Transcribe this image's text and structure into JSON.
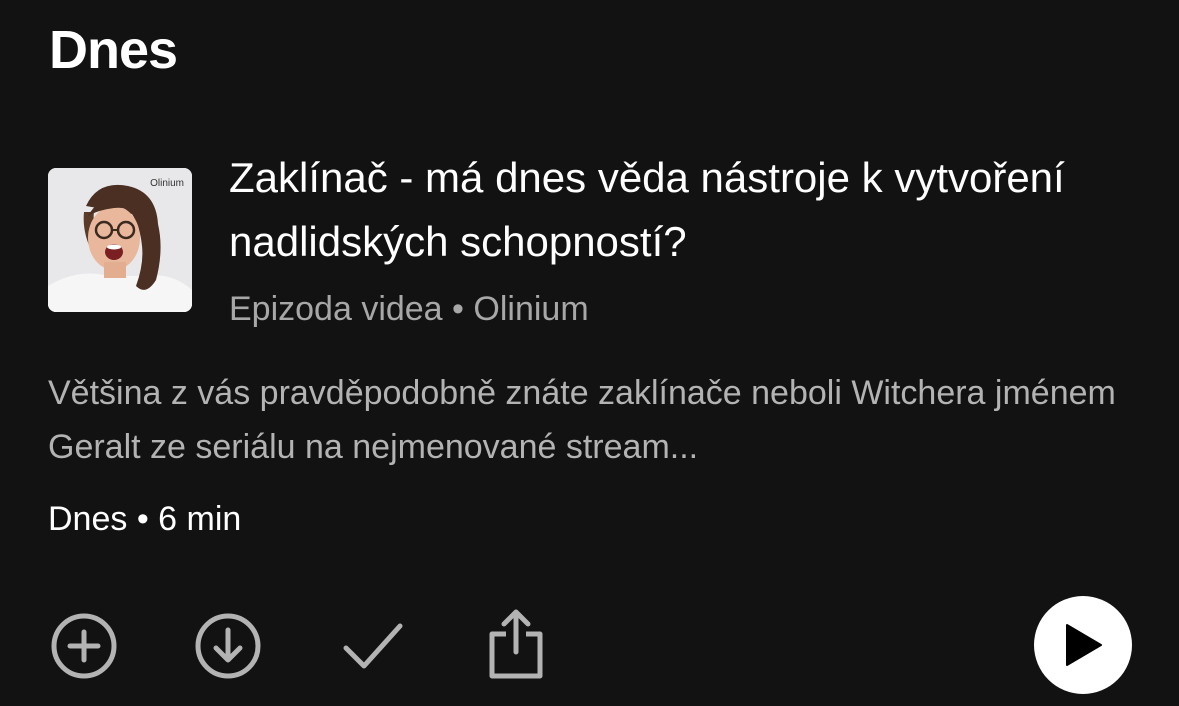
{
  "section": {
    "title": "Dnes"
  },
  "episode": {
    "cover_label": "Olinium",
    "title": "Zaklínač - má dnes věda nástroje k vytvoření nadlidských schopností?",
    "meta": "Epizoda videa • Olinium",
    "description": "Většina z vás pravděpodobně znáte zaklínače neboli Witchera jménem Geralt ze seriálu na nejmenované stream...",
    "date_line": "Dnes • 6 min"
  },
  "actions": {
    "add_icon": "plus-circle-icon",
    "download_icon": "download-circle-icon",
    "mark_played_icon": "checkmark-icon",
    "share_icon": "share-icon",
    "play_icon": "play-icon"
  },
  "colors": {
    "background": "#121212",
    "primary_text": "#ffffff",
    "secondary_text": "#a7a7a7",
    "icon": "#b3b3b3",
    "play_button": "#ffffff"
  }
}
